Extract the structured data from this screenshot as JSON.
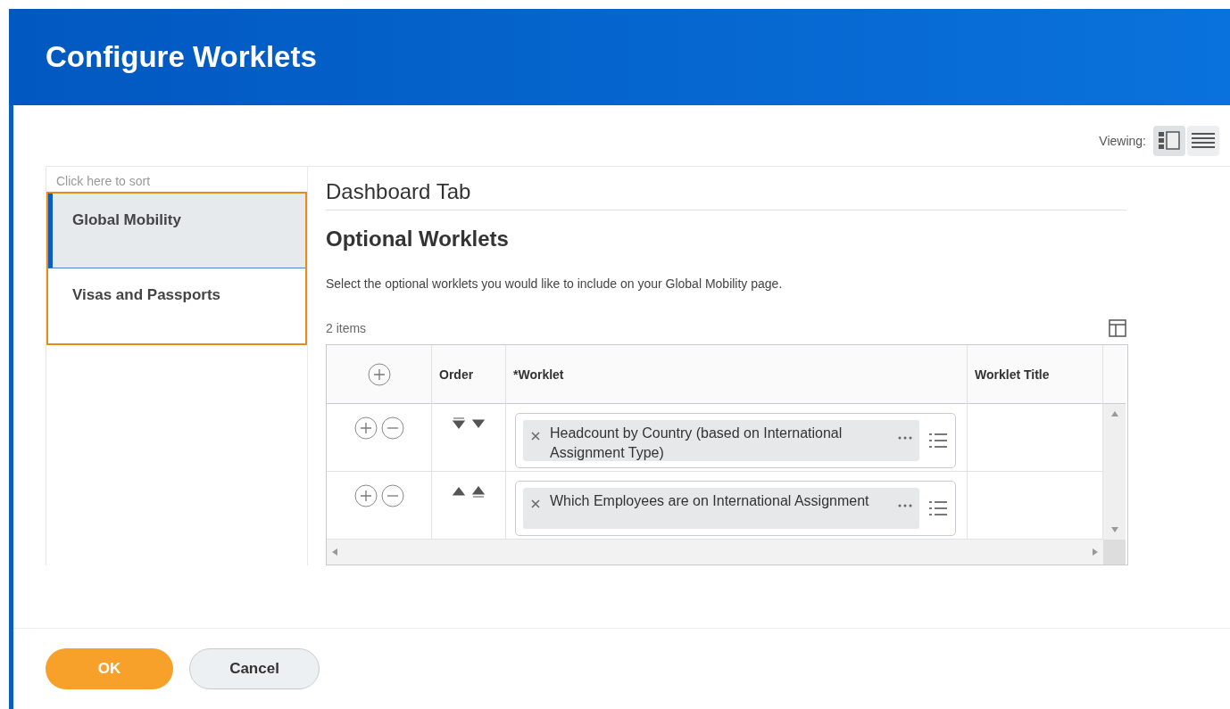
{
  "header": {
    "title": "Configure Worklets"
  },
  "viewing": {
    "label": "Viewing:",
    "modes": [
      {
        "kind": "split",
        "selected": true
      },
      {
        "kind": "list",
        "selected": false
      }
    ]
  },
  "sort_list": {
    "hint": "Click here to sort",
    "items": [
      {
        "label": "Global Mobility",
        "selected": true
      },
      {
        "label": "Visas and Passports",
        "selected": false
      }
    ]
  },
  "section": {
    "tab_title": "Dashboard Tab",
    "heading": "Optional Worklets",
    "instruction": "Select the optional worklets you would like to include on your Global Mobility page."
  },
  "table": {
    "count": "2 items",
    "columns": [
      "Order",
      "*Worklet",
      "Worklet Title"
    ],
    "rows": [
      {
        "can_move_up": false,
        "can_move_down": true,
        "worklet": "Headcount by Country (based on International Assignment Type)"
      },
      {
        "can_move_up": true,
        "can_move_down": false,
        "worklet": "Which Employees are on International Assignment"
      }
    ]
  },
  "buttons": [
    {
      "label": "OK",
      "kind": "primary"
    },
    {
      "label": "Cancel",
      "kind": "secondary"
    }
  ]
}
